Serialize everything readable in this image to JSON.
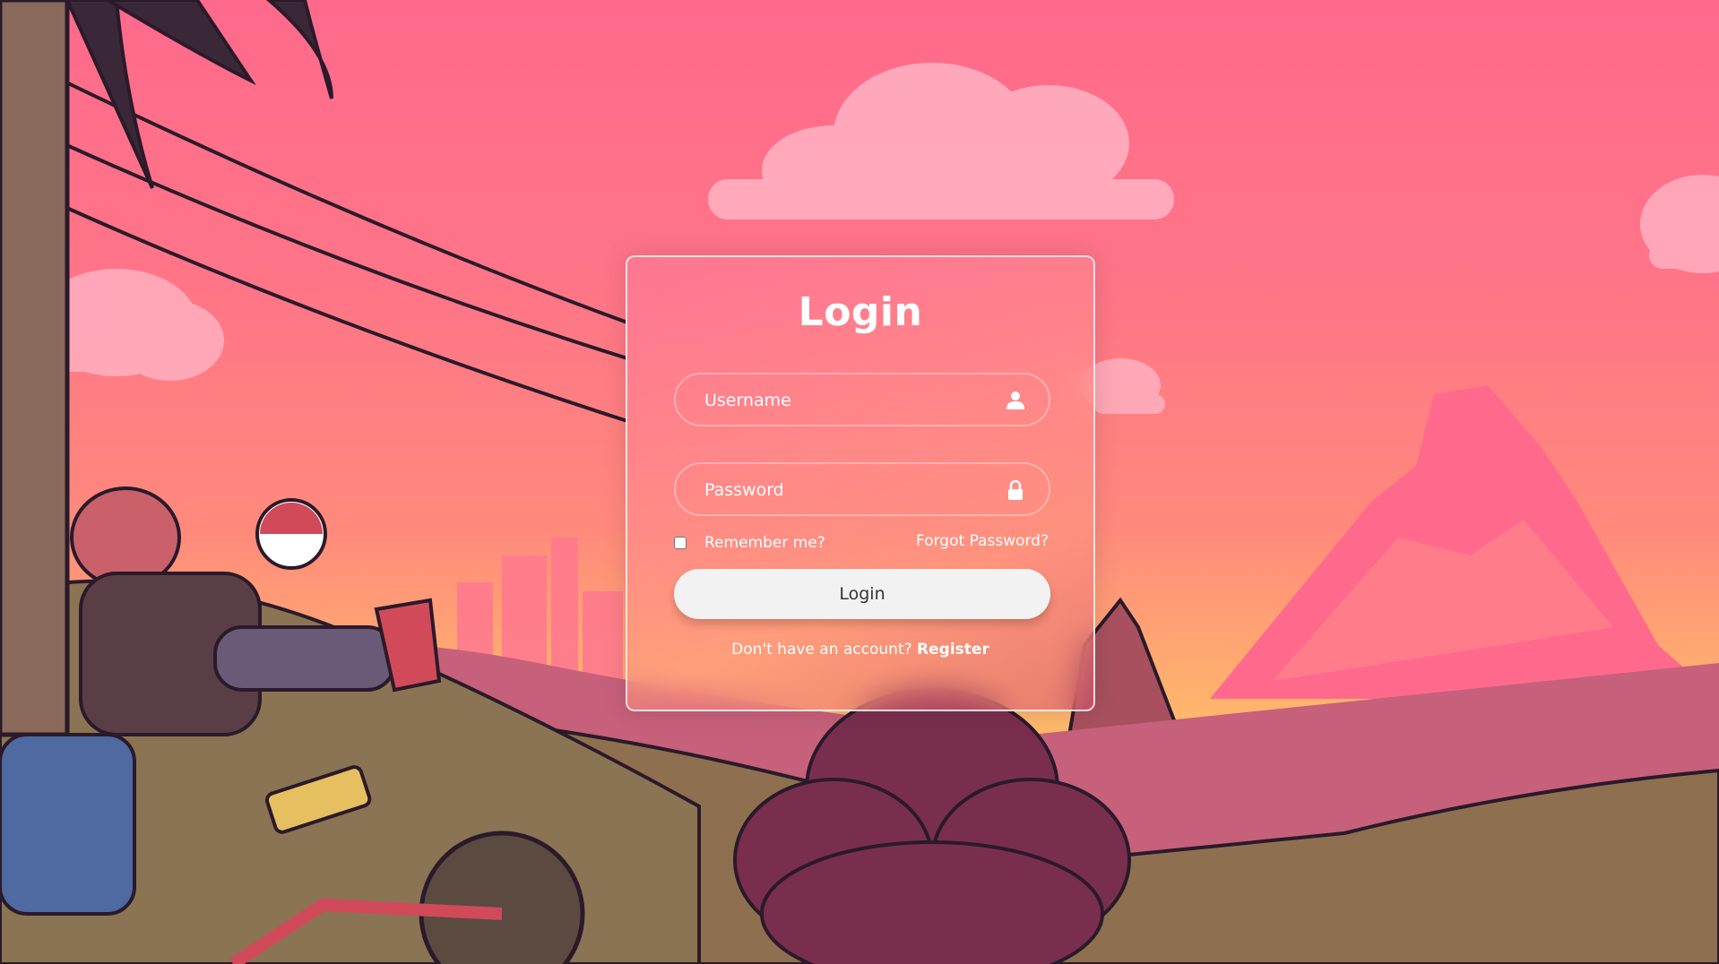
{
  "login": {
    "title": "Login",
    "username_placeholder": "Username",
    "password_placeholder": "Password",
    "remember_label": "Remember me?",
    "forgot_label": "Forgot Password?",
    "submit_label": "Login",
    "no_account_text": "Don't have an account?",
    "register_label": "Register"
  },
  "icons": {
    "username": "user-icon",
    "password": "lock-icon"
  },
  "colors": {
    "sky_top": "#ff6a8c",
    "sky_bottom": "#f7c46a",
    "button_bg": "#f2f2f2",
    "button_text": "#333333",
    "text": "#ffffff"
  }
}
